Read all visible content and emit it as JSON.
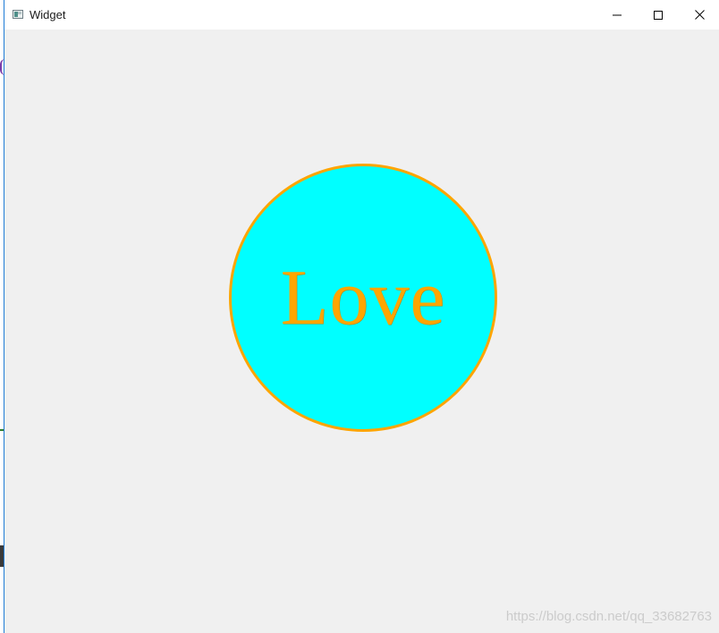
{
  "window": {
    "title": "Widget",
    "icon": "app-window-icon",
    "controls": {
      "minimize_icon": "minimize-icon",
      "maximize_icon": "maximize-icon",
      "close_icon": "close-icon"
    }
  },
  "canvas": {
    "background_color": "#f0f0f0",
    "circle": {
      "fill_color": "#00ffff",
      "stroke_color": "#ffa500",
      "text": "Love",
      "text_color": "#ffa500"
    }
  },
  "watermark": {
    "text": "https://blog.csdn.net/qq_33682763"
  }
}
